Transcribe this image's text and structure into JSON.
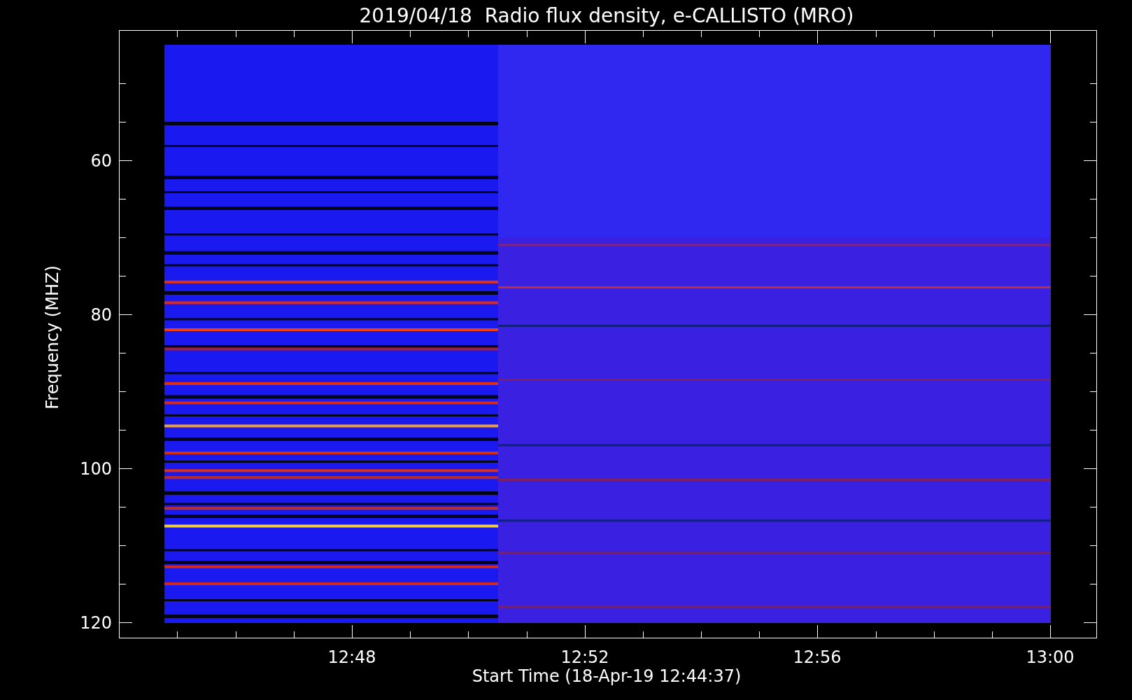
{
  "title": "2019/04/18  Radio flux density, e-CALLISTO (MRO)",
  "y_axis": {
    "label": "Frequency (MHZ)",
    "ticks": [
      "60",
      "80",
      "100",
      "120"
    ]
  },
  "x_axis": {
    "label": "Start Time (18-Apr-19 12:44:37)",
    "ticks": [
      "12:48",
      "12:52",
      "12:56",
      "13:00"
    ]
  }
}
